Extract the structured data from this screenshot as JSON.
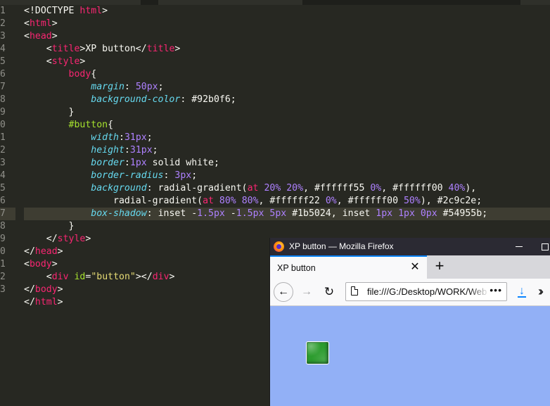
{
  "editor": {
    "line_numbers": [
      "1",
      "2",
      "3",
      "4",
      "5",
      "6",
      "7",
      "8",
      "9",
      "0",
      "1",
      "2",
      "3",
      "4",
      "5",
      "6",
      "7",
      "8",
      "9",
      "0",
      "1",
      "2",
      "3"
    ],
    "lines": [
      [
        {
          "c": "t-txt",
          "t": "<!DOCTYPE "
        },
        {
          "c": "t-tag",
          "t": "html"
        },
        {
          "c": "t-txt",
          "t": ">"
        }
      ],
      [
        {
          "c": "t-txt",
          "t": "<"
        },
        {
          "c": "t-tag",
          "t": "html"
        },
        {
          "c": "t-txt",
          "t": ">"
        }
      ],
      [
        {
          "c": "t-txt",
          "t": "<"
        },
        {
          "c": "t-tag",
          "t": "head"
        },
        {
          "c": "t-txt",
          "t": ">"
        }
      ],
      [
        {
          "c": "t-txt",
          "t": "    <"
        },
        {
          "c": "t-tag",
          "t": "title"
        },
        {
          "c": "t-txt",
          "t": ">XP button</"
        },
        {
          "c": "t-tag",
          "t": "title"
        },
        {
          "c": "t-txt",
          "t": ">"
        }
      ],
      [
        {
          "c": "t-txt",
          "t": "    <"
        },
        {
          "c": "t-tag",
          "t": "style"
        },
        {
          "c": "t-txt",
          "t": ">"
        }
      ],
      [
        {
          "c": "t-txt",
          "t": "        "
        },
        {
          "c": "t-tag",
          "t": "body"
        },
        {
          "c": "t-txt",
          "t": "{"
        }
      ],
      [
        {
          "c": "t-txt",
          "t": "            "
        },
        {
          "c": "t-prop",
          "t": "margin"
        },
        {
          "c": "t-txt",
          "t": ": "
        },
        {
          "c": "t-num",
          "t": "50px"
        },
        {
          "c": "t-txt",
          "t": ";"
        }
      ],
      [
        {
          "c": "t-txt",
          "t": "            "
        },
        {
          "c": "t-prop",
          "t": "background-color"
        },
        {
          "c": "t-txt",
          "t": ": #92b0f6;"
        }
      ],
      [
        {
          "c": "t-txt",
          "t": "        }"
        }
      ],
      [
        {
          "c": "t-txt",
          "t": "        "
        },
        {
          "c": "t-sel",
          "t": "#button"
        },
        {
          "c": "t-txt",
          "t": "{"
        }
      ],
      [
        {
          "c": "t-txt",
          "t": "            "
        },
        {
          "c": "t-prop",
          "t": "width"
        },
        {
          "c": "t-txt",
          "t": ":"
        },
        {
          "c": "t-num",
          "t": "31px"
        },
        {
          "c": "t-txt",
          "t": ";"
        }
      ],
      [
        {
          "c": "t-txt",
          "t": "            "
        },
        {
          "c": "t-prop",
          "t": "height"
        },
        {
          "c": "t-txt",
          "t": ":"
        },
        {
          "c": "t-num",
          "t": "31px"
        },
        {
          "c": "t-txt",
          "t": ";"
        }
      ],
      [
        {
          "c": "t-txt",
          "t": "            "
        },
        {
          "c": "t-prop",
          "t": "border"
        },
        {
          "c": "t-txt",
          "t": ":"
        },
        {
          "c": "t-num",
          "t": "1px"
        },
        {
          "c": "t-txt",
          "t": " solid white;"
        }
      ],
      [
        {
          "c": "t-txt",
          "t": "            "
        },
        {
          "c": "t-prop",
          "t": "border-radius"
        },
        {
          "c": "t-txt",
          "t": ": "
        },
        {
          "c": "t-num",
          "t": "3px"
        },
        {
          "c": "t-txt",
          "t": ";"
        }
      ],
      [
        {
          "c": "t-txt",
          "t": "            "
        },
        {
          "c": "t-prop",
          "t": "background"
        },
        {
          "c": "t-txt",
          "t": ": radial-gradient("
        },
        {
          "c": "t-tag",
          "t": "at"
        },
        {
          "c": "t-txt",
          "t": " "
        },
        {
          "c": "t-num",
          "t": "20%"
        },
        {
          "c": "t-txt",
          "t": " "
        },
        {
          "c": "t-num",
          "t": "20%"
        },
        {
          "c": "t-txt",
          "t": ", #ffffff55 "
        },
        {
          "c": "t-num",
          "t": "0%"
        },
        {
          "c": "t-txt",
          "t": ", #ffffff00 "
        },
        {
          "c": "t-num",
          "t": "40%"
        },
        {
          "c": "t-txt",
          "t": "),"
        }
      ],
      [
        {
          "c": "t-txt",
          "t": "                radial-gradient("
        },
        {
          "c": "t-tag",
          "t": "at"
        },
        {
          "c": "t-txt",
          "t": " "
        },
        {
          "c": "t-num",
          "t": "80%"
        },
        {
          "c": "t-txt",
          "t": " "
        },
        {
          "c": "t-num",
          "t": "80%"
        },
        {
          "c": "t-txt",
          "t": ", #ffffff22 "
        },
        {
          "c": "t-num",
          "t": "0%"
        },
        {
          "c": "t-txt",
          "t": ", #ffffff00 "
        },
        {
          "c": "t-num",
          "t": "50%"
        },
        {
          "c": "t-txt",
          "t": "), #2c9c2e;"
        }
      ],
      [
        {
          "c": "t-txt",
          "t": "            "
        },
        {
          "c": "t-prop",
          "t": "box-shadow"
        },
        {
          "c": "t-txt",
          "t": ": inset -"
        },
        {
          "c": "t-num",
          "t": "1.5px"
        },
        {
          "c": "t-txt",
          "t": " -"
        },
        {
          "c": "t-num",
          "t": "1.5px"
        },
        {
          "c": "t-txt",
          "t": " "
        },
        {
          "c": "t-num",
          "t": "5px"
        },
        {
          "c": "t-txt",
          "t": " #1b5024, inset "
        },
        {
          "c": "t-num",
          "t": "1px"
        },
        {
          "c": "t-txt",
          "t": " "
        },
        {
          "c": "t-num",
          "t": "1px"
        },
        {
          "c": "t-txt",
          "t": " "
        },
        {
          "c": "t-num",
          "t": "0px"
        },
        {
          "c": "t-txt",
          "t": " #54955b;"
        }
      ],
      [
        {
          "c": "t-txt",
          "t": "        }"
        }
      ],
      [
        {
          "c": "t-txt",
          "t": "    </"
        },
        {
          "c": "t-tag",
          "t": "style"
        },
        {
          "c": "t-txt",
          "t": ">"
        }
      ],
      [
        {
          "c": "t-txt",
          "t": "</"
        },
        {
          "c": "t-tag",
          "t": "head"
        },
        {
          "c": "t-txt",
          "t": ">"
        }
      ],
      [
        {
          "c": "t-txt",
          "t": "<"
        },
        {
          "c": "t-tag",
          "t": "body"
        },
        {
          "c": "t-txt",
          "t": ">"
        }
      ],
      [
        {
          "c": "t-txt",
          "t": "    <"
        },
        {
          "c": "t-tag",
          "t": "div"
        },
        {
          "c": "t-txt",
          "t": " "
        },
        {
          "c": "t-attr",
          "t": "id"
        },
        {
          "c": "t-txt",
          "t": "="
        },
        {
          "c": "t-str",
          "t": "\"button\""
        },
        {
          "c": "t-txt",
          "t": "></"
        },
        {
          "c": "t-tag",
          "t": "div"
        },
        {
          "c": "t-txt",
          "t": ">"
        }
      ],
      [
        {
          "c": "t-txt",
          "t": "</"
        },
        {
          "c": "t-tag",
          "t": "body"
        },
        {
          "c": "t-txt",
          "t": ">"
        }
      ],
      [
        {
          "c": "t-txt",
          "t": "</"
        },
        {
          "c": "t-tag",
          "t": "html"
        },
        {
          "c": "t-txt",
          "t": ">"
        }
      ]
    ],
    "current_line_index": 16,
    "colors": {
      "background": "#272822",
      "tag": "#f92672",
      "property": "#66d9ef",
      "number": "#ae81ff",
      "string": "#e6db74",
      "selector": "#a6e22e"
    }
  },
  "browser": {
    "window_title": "XP button — Mozilla Firefox",
    "tab_label": "XP button",
    "tab_close_icon": "close-icon",
    "new_tab_label": "+",
    "url": "file:///G:/Desktop/WORK/Web",
    "url_more": "•••",
    "colors": {
      "page_background": "#92b0f6",
      "button_color": "#2c9c2e",
      "accent": "#0a84ff"
    }
  }
}
